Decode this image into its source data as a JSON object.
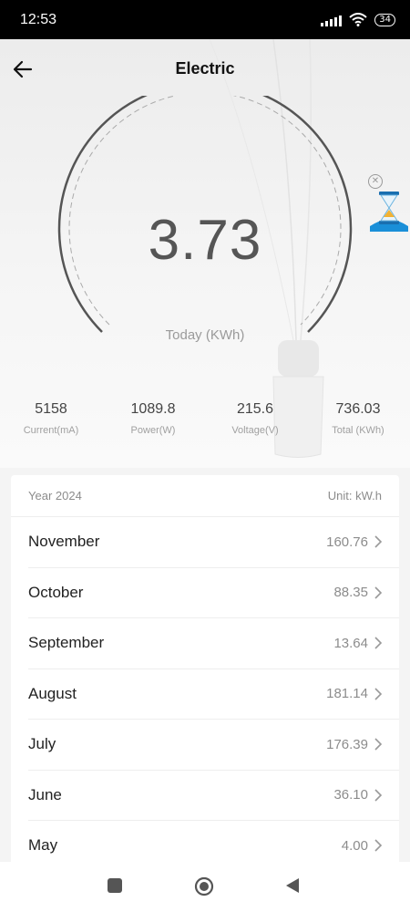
{
  "status_bar": {
    "time": "12:53",
    "battery": "34"
  },
  "header": {
    "title": "Electric"
  },
  "gauge": {
    "value": "3.73",
    "label": "Today (KWh)"
  },
  "stats": [
    {
      "value": "5158",
      "label": "Current(mA)"
    },
    {
      "value": "1089.8",
      "label": "Power(W)"
    },
    {
      "value": "215.6",
      "label": "Voltage(V)"
    },
    {
      "value": "736.03",
      "label": "Total (KWh)"
    }
  ],
  "history": {
    "year_label": "Year 2024",
    "unit_label": "Unit: kW.h",
    "months": [
      {
        "name": "November",
        "value": "160.76"
      },
      {
        "name": "October",
        "value": "88.35"
      },
      {
        "name": "September",
        "value": "13.64"
      },
      {
        "name": "August",
        "value": "181.14"
      },
      {
        "name": "July",
        "value": "176.39"
      },
      {
        "name": "June",
        "value": "36.10"
      },
      {
        "name": "May",
        "value": "4.00"
      }
    ]
  },
  "colors": {
    "text_dark": "#222222",
    "text_muted": "#8c8c8c",
    "gauge_arc": "#555555",
    "ad_blue": "#1a8fd8"
  },
  "icons": [
    "back-arrow-icon",
    "close-icon",
    "hourglass-icon",
    "chevron-right-icon",
    "square-icon",
    "circle-icon",
    "triangle-back-icon"
  ]
}
